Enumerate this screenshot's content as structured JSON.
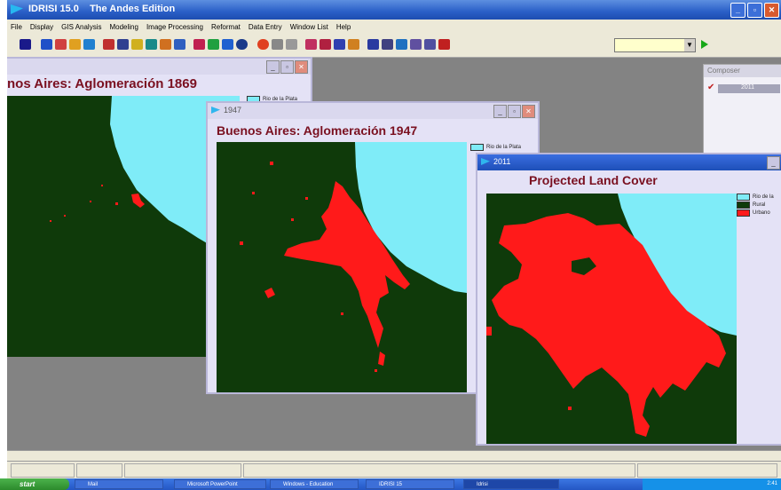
{
  "app": {
    "title": "IDRISI 15.0    The Andes Edition",
    "menu": [
      "File",
      "Display",
      "GIS Analysis",
      "Modeling",
      "Image Processing",
      "Reformat",
      "Data Entry",
      "Window List",
      "Help"
    ]
  },
  "toolbar": {
    "icons": [
      "open-icon",
      "display-icon",
      "composer-icon",
      "zoom-icon",
      "pan-icon",
      "query-icon",
      "raster-icon",
      "vector-icon",
      "layout-icon",
      "legend-icon",
      "digitize-icon",
      "edit-icon",
      "measure-icon",
      "globe-icon",
      "target-icon",
      "cross-icon",
      "arrow-icon",
      "chart-icon",
      "histogram-icon",
      "profile-icon",
      "stats-icon",
      "grid-icon",
      "table-icon",
      "palette-icon",
      "model-icon",
      "settings-icon"
    ],
    "combo_value": ""
  },
  "windows": {
    "w1869": {
      "title": "",
      "map_title": "nos Aires: Aglomeración 1869",
      "legend": [
        "Rio de la Plata"
      ]
    },
    "w1947": {
      "title": "1947",
      "map_title": "Buenos Aires: Aglomeración 1947",
      "legend": [
        "Rio de la Plata"
      ]
    },
    "w2011": {
      "title": "2011",
      "map_title": "Projected Land Cover",
      "legend": [
        "Rio de la",
        "Rural",
        "Urbano"
      ]
    }
  },
  "composer": {
    "title": "Composer",
    "layer": "2011"
  },
  "colors": {
    "water": "#7fecf8",
    "rural": "#0f3a0a",
    "urban": "#ff1a1a"
  },
  "taskbar": {
    "start": "start",
    "tasks": [
      "Mail",
      "Microsoft PowerPoint",
      "Windows - Education",
      "IDRISI 15",
      "Idrisi"
    ],
    "tray_time": "2:41"
  }
}
